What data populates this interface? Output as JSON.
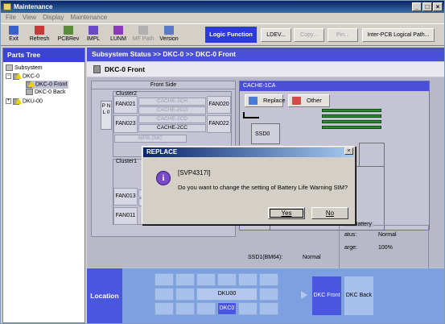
{
  "window": {
    "title": "Maintenance",
    "controls": [
      "_",
      "□",
      "×"
    ]
  },
  "menu": [
    "File",
    "View",
    "Display",
    "Maintenance"
  ],
  "toolbar": {
    "items": [
      {
        "label": "Exit",
        "color": "#3a5fc8"
      },
      {
        "label": "Refresh",
        "color": "#c83a3a"
      },
      {
        "label": "PCBRev",
        "color": "#5a8a3a"
      },
      {
        "label": "IMPL",
        "color": "#6a4ac8"
      },
      {
        "label": "LUNM",
        "color": "#8a3ab8"
      },
      {
        "label": "MF Path",
        "color": "#9a9a9a",
        "disabled": true
      },
      {
        "label": "Version",
        "color": "#5a7ac8"
      }
    ],
    "logic_function": "Logic Function",
    "buttons": [
      {
        "label": "LDEV...",
        "disabled": false
      },
      {
        "label": "Copy...",
        "disabled": true
      },
      {
        "label": "Pin...",
        "disabled": true
      },
      {
        "label": "Inter-PCB Logical Path...",
        "disabled": false
      }
    ]
  },
  "parts_tree": {
    "title": "Parts Tree",
    "nodes": [
      "Subsystem",
      "DKC-0",
      "DKC-0 Front",
      "DKC-0 Back",
      "DKU-00"
    ]
  },
  "status": {
    "breadcrumb": "Subsystem Status >> DKC-0 >> DKC-0 Front",
    "page_title": "DKC-0 Front"
  },
  "front_side": {
    "title": "Front Side",
    "pnl": "P N L 0",
    "cluster2": "Cluster2",
    "cluster1": "Cluster1",
    "fans": [
      "FAN021",
      "FAN020",
      "FAN023",
      "FAN022",
      "FAN013",
      "FAN011"
    ],
    "caches": [
      "CACHE-2CH",
      "CACHE-2CG",
      "CACHE-2CD",
      "CACHE-2CC",
      "MPB-2MC"
    ]
  },
  "cache_panel": {
    "title": "CACHE-1CA",
    "replace": "Replace",
    "other": "Other",
    "ssd0": "SSD0",
    "ssd1_label": "SSD1(BM64):",
    "ssd1_value": "Normal",
    "battery_title": "he Battery",
    "status_label": "atus:",
    "status_value": "Normal",
    "charge_label": "arge:",
    "charge_value": "100%"
  },
  "dialog": {
    "title": "REPLACE",
    "code": "[SVP4317I]",
    "message": "Do you want to change the setting of Battery Life Warning SIM?",
    "yes": "Yes",
    "no": "No"
  },
  "location": {
    "label": "Location",
    "dku": "DKU00",
    "dkc": "DKC0",
    "dkc_front": "DKC Front",
    "dkc_back": "DKC Back"
  }
}
